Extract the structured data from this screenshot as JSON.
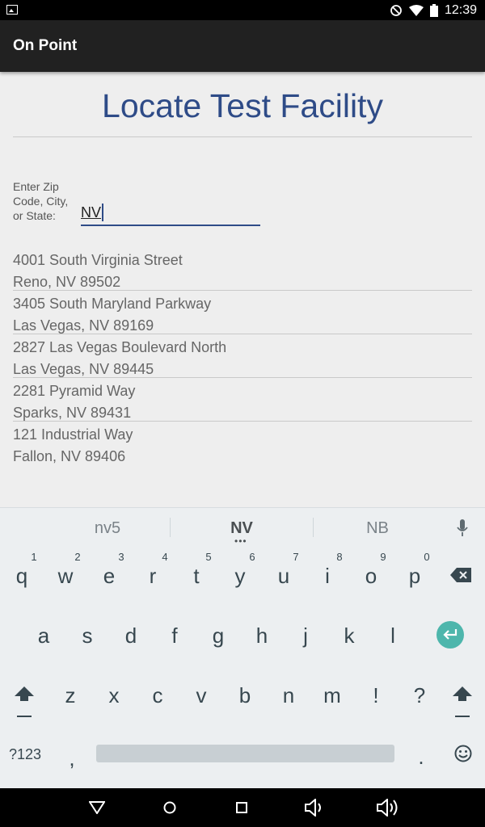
{
  "status_bar": {
    "time": "12:39"
  },
  "app_bar": {
    "title": "On Point"
  },
  "page": {
    "heading": "Locate Test Facility",
    "zip_label": "Enter Zip Code, City, or State:",
    "zip_value": "NV"
  },
  "results": [
    {
      "street": "4001 South Virginia Street",
      "city": "Reno, NV 89502"
    },
    {
      "street": "3405 South Maryland Parkway",
      "city": "Las Vegas, NV 89169"
    },
    {
      "street": "2827 Las Vegas Boulevard North",
      "city": "Las Vegas, NV 89445"
    },
    {
      "street": "2281 Pyramid Way",
      "city": "Sparks, NV 89431"
    },
    {
      "street": "121 Industrial Way",
      "city": "Fallon, NV 89406"
    }
  ],
  "keyboard": {
    "suggestions": [
      "nv5",
      "NV",
      "NB"
    ],
    "selected_dots": "•••",
    "row1": [
      "q",
      "w",
      "e",
      "r",
      "t",
      "y",
      "u",
      "i",
      "o",
      "p"
    ],
    "row1_hints": [
      "1",
      "2",
      "3",
      "4",
      "5",
      "6",
      "7",
      "8",
      "9",
      "0"
    ],
    "row2": [
      "a",
      "s",
      "d",
      "f",
      "g",
      "h",
      "j",
      "k",
      "l"
    ],
    "row3": [
      "z",
      "x",
      "c",
      "v",
      "b",
      "n",
      "m",
      "!",
      "?"
    ],
    "symbols_key": "?123",
    "comma": ",",
    "period": ".",
    "accent_color": "#4db6ac"
  },
  "colors": {
    "heading": "#2e4b87",
    "appbar": "#212121"
  }
}
